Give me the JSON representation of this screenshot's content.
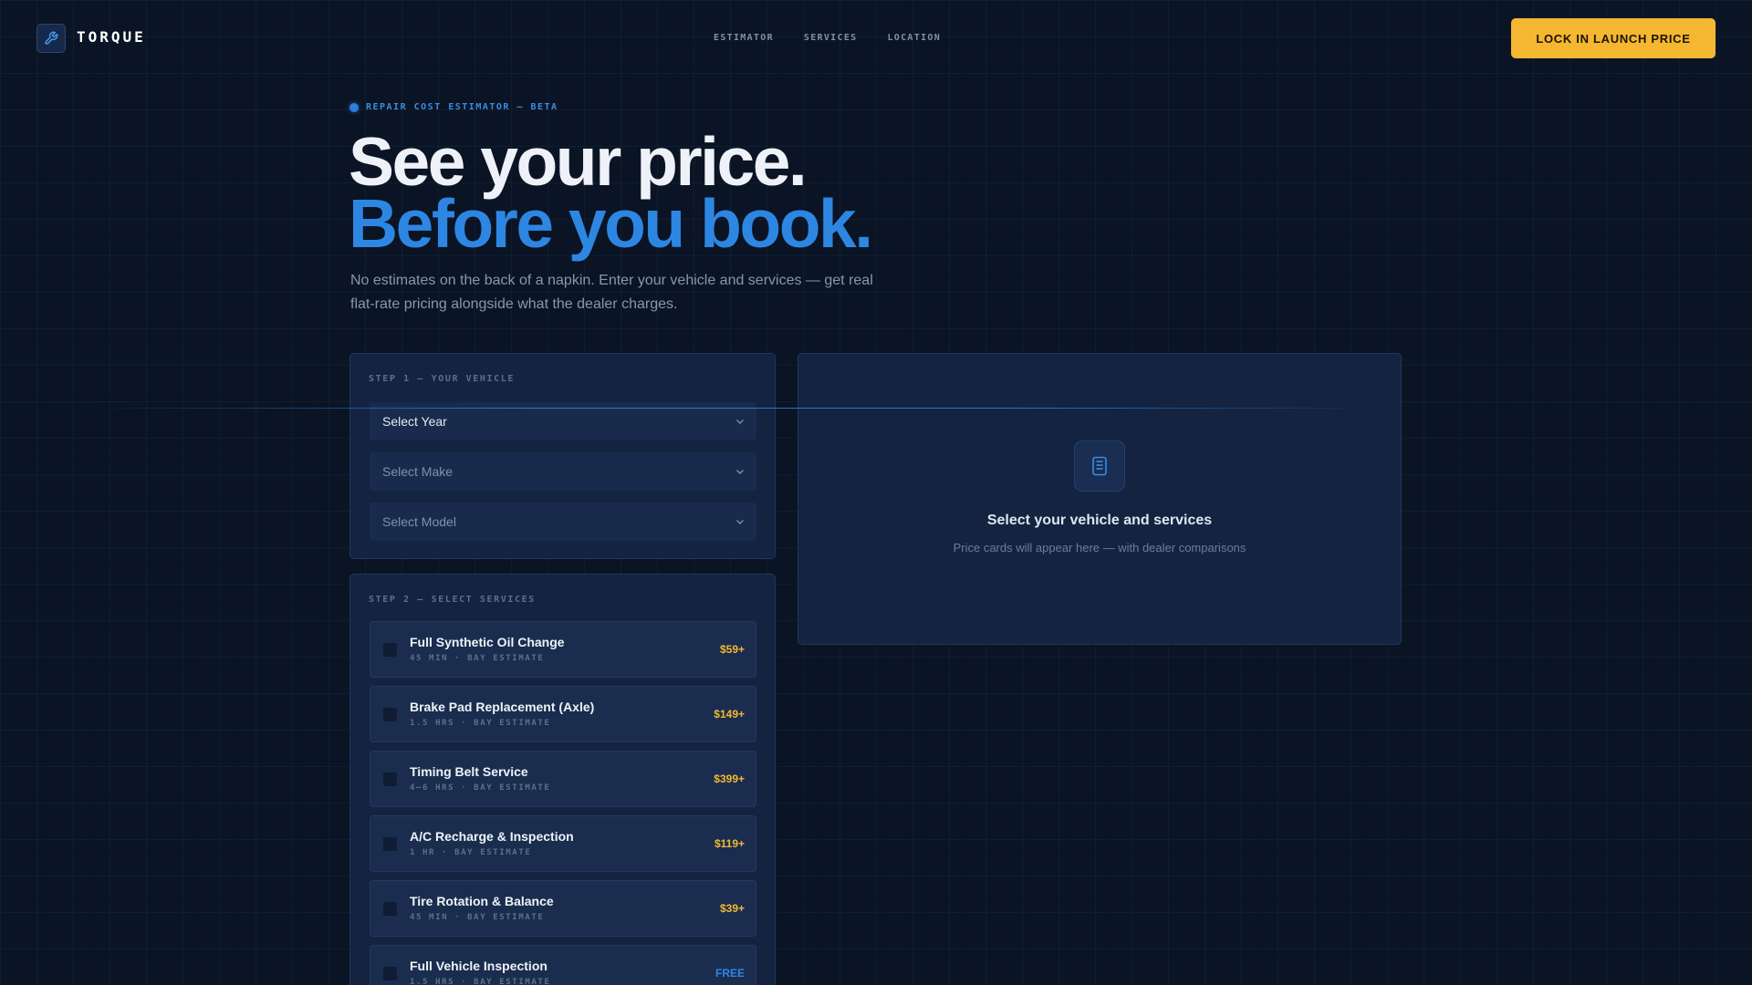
{
  "brand": {
    "name": "TORQUE",
    "icon": "wrench-icon"
  },
  "nav": [
    {
      "label": "ESTIMATOR"
    },
    {
      "label": "SERVICES"
    },
    {
      "label": "LOCATION"
    }
  ],
  "cta": {
    "label": "LOCK IN LAUNCH PRICE"
  },
  "hero": {
    "kicker": "REPAIR COST ESTIMATOR — BETA",
    "title_line1": "See your price.",
    "title_line2": "Before you book.",
    "subtitle": "No estimates on the back of a napkin. Enter your vehicle and services — get real flat-rate pricing alongside what the dealer charges."
  },
  "vehicle": {
    "label": "STEP 1 — YOUR VEHICLE",
    "selects": [
      {
        "value": "Select Year"
      },
      {
        "value": "Select Make"
      },
      {
        "value": "Select Model"
      }
    ]
  },
  "services": {
    "label": "STEP 2 — SELECT SERVICES",
    "items": [
      {
        "name": "Full Synthetic Oil Change",
        "meta": "45 MIN · BAY ESTIMATE",
        "price": "$59+"
      },
      {
        "name": "Brake Pad Replacement (Axle)",
        "meta": "1.5 HRS · BAY ESTIMATE",
        "price": "$149+"
      },
      {
        "name": "Timing Belt Service",
        "meta": "4–6 HRS · BAY ESTIMATE",
        "price": "$399+"
      },
      {
        "name": "A/C Recharge & Inspection",
        "meta": "1 HR · BAY ESTIMATE",
        "price": "$119+"
      },
      {
        "name": "Tire Rotation & Balance",
        "meta": "45 MIN · BAY ESTIMATE",
        "price": "$39+"
      },
      {
        "name": "Full Vehicle Inspection",
        "meta": "1.5 HRS · BAY ESTIMATE",
        "price": "FREE"
      }
    ]
  },
  "results": {
    "icon": "calculator-icon",
    "title": "Select your vehicle and services",
    "subtitle": "Price cards will appear here — with dealer comparisons"
  },
  "colors": {
    "background": "#0a1424",
    "accent_blue": "#2e86e3",
    "accent_yellow": "#f5b731",
    "panel": "#132340"
  }
}
